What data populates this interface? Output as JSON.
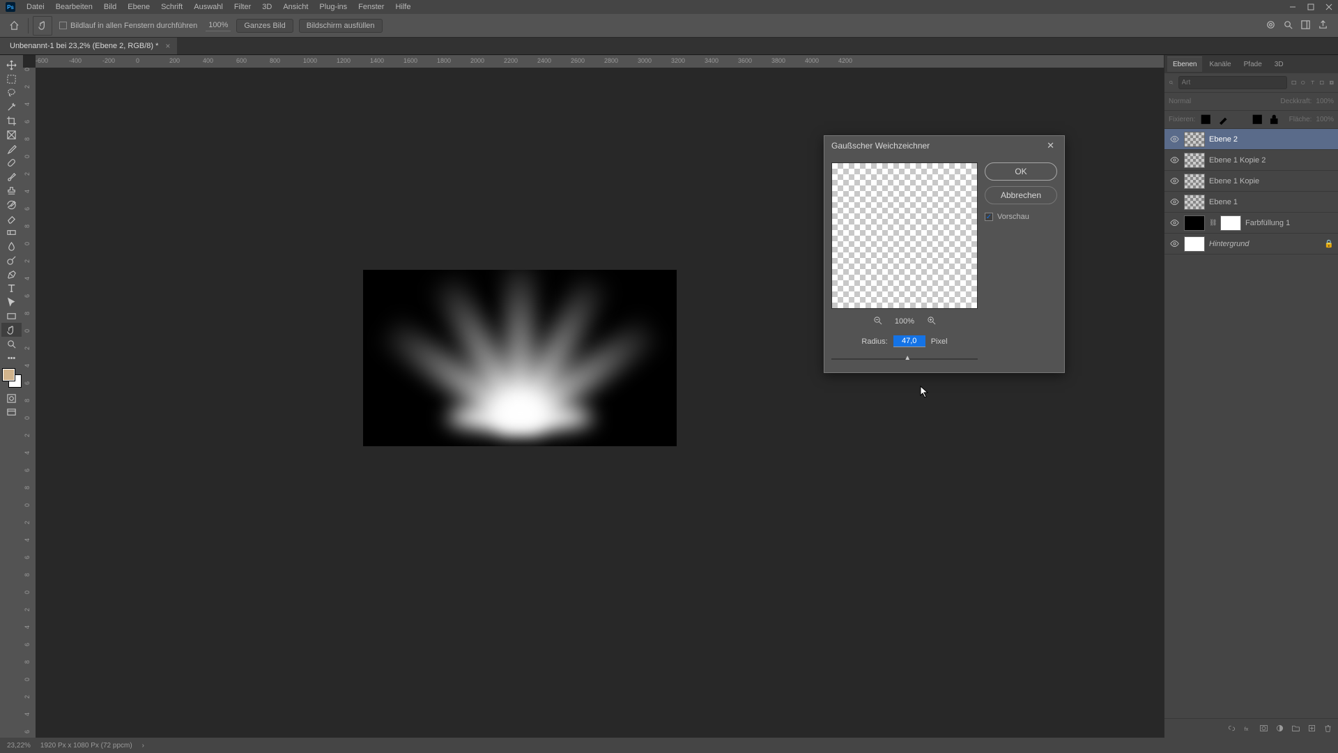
{
  "menu": {
    "items": [
      "Datei",
      "Bearbeiten",
      "Bild",
      "Ebene",
      "Schrift",
      "Auswahl",
      "Filter",
      "3D",
      "Ansicht",
      "Plug-ins",
      "Fenster",
      "Hilfe"
    ]
  },
  "options": {
    "scroll_checkbox": "Bildlauf in allen Fenstern durchführen",
    "zoom_value": "100%",
    "btn_fit": "Ganzes Bild",
    "btn_fill": "Bildschirm ausfüllen"
  },
  "tab": {
    "title": "Unbenannt-1 bei 23,2% (Ebene 2, RGB/8) *"
  },
  "ruler_h": [
    "-600",
    "-400",
    "-200",
    "0",
    "200",
    "400",
    "600",
    "800",
    "1000",
    "1200",
    "1400",
    "1600",
    "1800",
    "2000",
    "2200",
    "2400",
    "2600",
    "2800",
    "3000",
    "3200",
    "3400",
    "3600",
    "3800",
    "4000",
    "4200"
  ],
  "ruler_v": [
    "0",
    "2\n0\n0",
    "4\n0\n0",
    "6\n0\n0",
    "8\n0\n0",
    "1\n0\n0\n0",
    "1\n2\n0\n0",
    "1\n4\n0\n0",
    "1\n6\n0\n0",
    "1\n8\n0\n0",
    "2\n0\n0\n0"
  ],
  "dialog": {
    "title": "Gaußscher Weichzeichner",
    "ok": "OK",
    "cancel": "Abbrechen",
    "preview": "Vorschau",
    "radius_label": "Radius:",
    "radius_value": "47,0",
    "radius_unit": "Pixel",
    "zoom": "100%"
  },
  "panels": {
    "tabs": [
      "Ebenen",
      "Kanäle",
      "Pfade",
      "3D"
    ],
    "filter_placeholder": "Art",
    "blend_mode": "Normal",
    "opacity_label": "Deckkraft:",
    "opacity_value": "100%",
    "lock_label": "Fixieren:",
    "fill_label": "Fläche:",
    "fill_value": "100%",
    "layers": [
      {
        "name": "Ebene 2"
      },
      {
        "name": "Ebene 1 Kopie 2"
      },
      {
        "name": "Ebene 1 Kopie"
      },
      {
        "name": "Ebene 1"
      },
      {
        "name": "Farbfüllung 1"
      },
      {
        "name": "Hintergrund"
      }
    ]
  },
  "status": {
    "zoom": "23,22%",
    "doc_info": "1920 Px x 1080 Px (72 ppcm)"
  }
}
